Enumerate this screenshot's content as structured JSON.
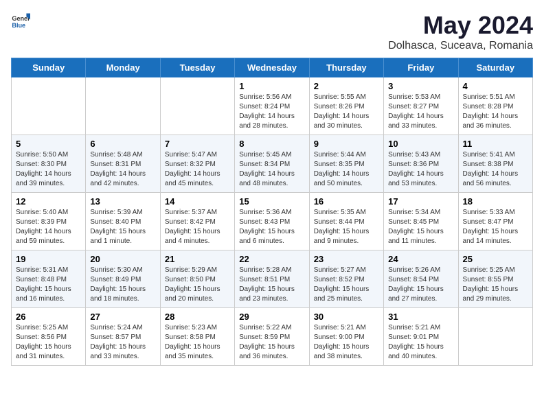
{
  "header": {
    "logo_general": "General",
    "logo_blue": "Blue",
    "title": "May 2024",
    "subtitle": "Dolhasca, Suceava, Romania"
  },
  "days_of_week": [
    "Sunday",
    "Monday",
    "Tuesday",
    "Wednesday",
    "Thursday",
    "Friday",
    "Saturday"
  ],
  "weeks": [
    [
      {
        "num": "",
        "text": ""
      },
      {
        "num": "",
        "text": ""
      },
      {
        "num": "",
        "text": ""
      },
      {
        "num": "1",
        "text": "Sunrise: 5:56 AM\nSunset: 8:24 PM\nDaylight: 14 hours\nand 28 minutes."
      },
      {
        "num": "2",
        "text": "Sunrise: 5:55 AM\nSunset: 8:26 PM\nDaylight: 14 hours\nand 30 minutes."
      },
      {
        "num": "3",
        "text": "Sunrise: 5:53 AM\nSunset: 8:27 PM\nDaylight: 14 hours\nand 33 minutes."
      },
      {
        "num": "4",
        "text": "Sunrise: 5:51 AM\nSunset: 8:28 PM\nDaylight: 14 hours\nand 36 minutes."
      }
    ],
    [
      {
        "num": "5",
        "text": "Sunrise: 5:50 AM\nSunset: 8:30 PM\nDaylight: 14 hours\nand 39 minutes."
      },
      {
        "num": "6",
        "text": "Sunrise: 5:48 AM\nSunset: 8:31 PM\nDaylight: 14 hours\nand 42 minutes."
      },
      {
        "num": "7",
        "text": "Sunrise: 5:47 AM\nSunset: 8:32 PM\nDaylight: 14 hours\nand 45 minutes."
      },
      {
        "num": "8",
        "text": "Sunrise: 5:45 AM\nSunset: 8:34 PM\nDaylight: 14 hours\nand 48 minutes."
      },
      {
        "num": "9",
        "text": "Sunrise: 5:44 AM\nSunset: 8:35 PM\nDaylight: 14 hours\nand 50 minutes."
      },
      {
        "num": "10",
        "text": "Sunrise: 5:43 AM\nSunset: 8:36 PM\nDaylight: 14 hours\nand 53 minutes."
      },
      {
        "num": "11",
        "text": "Sunrise: 5:41 AM\nSunset: 8:38 PM\nDaylight: 14 hours\nand 56 minutes."
      }
    ],
    [
      {
        "num": "12",
        "text": "Sunrise: 5:40 AM\nSunset: 8:39 PM\nDaylight: 14 hours\nand 59 minutes."
      },
      {
        "num": "13",
        "text": "Sunrise: 5:39 AM\nSunset: 8:40 PM\nDaylight: 15 hours\nand 1 minute."
      },
      {
        "num": "14",
        "text": "Sunrise: 5:37 AM\nSunset: 8:42 PM\nDaylight: 15 hours\nand 4 minutes."
      },
      {
        "num": "15",
        "text": "Sunrise: 5:36 AM\nSunset: 8:43 PM\nDaylight: 15 hours\nand 6 minutes."
      },
      {
        "num": "16",
        "text": "Sunrise: 5:35 AM\nSunset: 8:44 PM\nDaylight: 15 hours\nand 9 minutes."
      },
      {
        "num": "17",
        "text": "Sunrise: 5:34 AM\nSunset: 8:45 PM\nDaylight: 15 hours\nand 11 minutes."
      },
      {
        "num": "18",
        "text": "Sunrise: 5:33 AM\nSunset: 8:47 PM\nDaylight: 15 hours\nand 14 minutes."
      }
    ],
    [
      {
        "num": "19",
        "text": "Sunrise: 5:31 AM\nSunset: 8:48 PM\nDaylight: 15 hours\nand 16 minutes."
      },
      {
        "num": "20",
        "text": "Sunrise: 5:30 AM\nSunset: 8:49 PM\nDaylight: 15 hours\nand 18 minutes."
      },
      {
        "num": "21",
        "text": "Sunrise: 5:29 AM\nSunset: 8:50 PM\nDaylight: 15 hours\nand 20 minutes."
      },
      {
        "num": "22",
        "text": "Sunrise: 5:28 AM\nSunset: 8:51 PM\nDaylight: 15 hours\nand 23 minutes."
      },
      {
        "num": "23",
        "text": "Sunrise: 5:27 AM\nSunset: 8:52 PM\nDaylight: 15 hours\nand 25 minutes."
      },
      {
        "num": "24",
        "text": "Sunrise: 5:26 AM\nSunset: 8:54 PM\nDaylight: 15 hours\nand 27 minutes."
      },
      {
        "num": "25",
        "text": "Sunrise: 5:25 AM\nSunset: 8:55 PM\nDaylight: 15 hours\nand 29 minutes."
      }
    ],
    [
      {
        "num": "26",
        "text": "Sunrise: 5:25 AM\nSunset: 8:56 PM\nDaylight: 15 hours\nand 31 minutes."
      },
      {
        "num": "27",
        "text": "Sunrise: 5:24 AM\nSunset: 8:57 PM\nDaylight: 15 hours\nand 33 minutes."
      },
      {
        "num": "28",
        "text": "Sunrise: 5:23 AM\nSunset: 8:58 PM\nDaylight: 15 hours\nand 35 minutes."
      },
      {
        "num": "29",
        "text": "Sunrise: 5:22 AM\nSunset: 8:59 PM\nDaylight: 15 hours\nand 36 minutes."
      },
      {
        "num": "30",
        "text": "Sunrise: 5:21 AM\nSunset: 9:00 PM\nDaylight: 15 hours\nand 38 minutes."
      },
      {
        "num": "31",
        "text": "Sunrise: 5:21 AM\nSunset: 9:01 PM\nDaylight: 15 hours\nand 40 minutes."
      },
      {
        "num": "",
        "text": ""
      }
    ]
  ]
}
